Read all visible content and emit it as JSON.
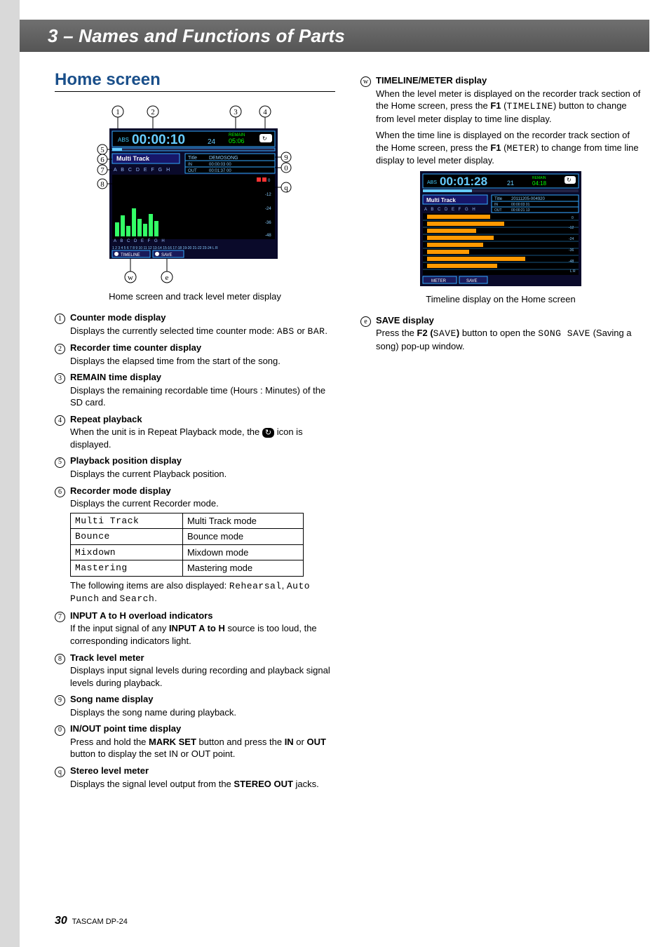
{
  "chapter_header": "3 – Names and Functions of Parts",
  "section_title": "Home screen",
  "main_caption": "Home screen and track level meter display",
  "timeline_caption": "Timeline display on the Home screen",
  "page_number": "30",
  "model": "TASCAM DP-24",
  "modes_table": [
    {
      "code": "Multi Track",
      "desc": "Multi Track mode"
    },
    {
      "code": "Bounce",
      "desc": "Bounce mode"
    },
    {
      "code": "Mixdown",
      "desc": "Mixdown mode"
    },
    {
      "code": "Mastering",
      "desc": "Mastering mode"
    }
  ],
  "items": {
    "1": {
      "n": "1",
      "title": "Counter mode display",
      "desc_a": "Displays the currently selected time counter mode: ",
      "mono_a": "ABS",
      "desc_b": " or ",
      "mono_b": "BAR",
      "desc_c": "."
    },
    "2": {
      "n": "2",
      "title": "Recorder time counter display",
      "desc": " Displays the elapsed time from the start of the song."
    },
    "3": {
      "n": "3",
      "title": "REMAIN time display",
      "desc": " Displays the remaining recordable time (Hours : Minutes) of the SD card."
    },
    "4": {
      "n": "4",
      "title": "Repeat playback",
      "desc_a": "When the unit is in Repeat Playback mode, the ",
      "desc_b": " icon is displayed."
    },
    "5": {
      "n": "5",
      "title": "Playback position display",
      "desc": "Displays the current Playback position."
    },
    "6": {
      "n": "6",
      "title": "Recorder mode display",
      "desc": "Displays the current Recorder mode.",
      "after_a": "The following items are also displayed: ",
      "mono_a": "Rehearsal",
      "after_b": ", ",
      "mono_b": "Auto Punch",
      "after_c": " and ",
      "mono_c": "Search",
      "after_d": "."
    },
    "7": {
      "n": "7",
      "title": "INPUT A to H overload indicators",
      "desc_a": "If the input signal of any ",
      "bold": "INPUT A to H",
      "desc_b": " source is too loud, the corresponding indicators light."
    },
    "8": {
      "n": "8",
      "title": "Track level meter",
      "desc": "Displays input signal levels during recording and playback signal levels during playback."
    },
    "9": {
      "n": "9",
      "title": "Song name display",
      "desc": "Displays the song name during playback."
    },
    "10": {
      "n": "0",
      "title": "IN/OUT point time display",
      "desc_a": "Press and hold the ",
      "bold_a": "MARK SET",
      "desc_b": " button and press the ",
      "bold_b": "IN",
      "desc_c": " or ",
      "bold_c": "OUT",
      "desc_d": " button to display the set IN or OUT point."
    },
    "11": {
      "n": "q",
      "title": "Stereo level meter",
      "desc_a": "Displays the signal level output from the ",
      "bold": "STEREO OUT",
      "desc_b": " jacks."
    },
    "12": {
      "n": "w",
      "title": "TIMELINE/METER display",
      "p1_a": "When the level meter is displayed on the recorder track section of the Home screen, press the ",
      "p1_bold": "F1",
      "p1_b": " (",
      "p1_mono": "TIMELINE",
      "p1_c": ") button to change from level meter display to time line display.",
      "p2_a": "When the time line is displayed on the recorder track section of the Home screen, press the ",
      "p2_bold": "F1",
      "p2_b": " (",
      "p2_mono": "METER",
      "p2_c": ") to change from time line display to level meter display."
    },
    "13": {
      "n": "e",
      "title": "SAVE display",
      "desc_a": "Press the ",
      "bold": "F2 (",
      "mono": "SAVE",
      "bold2": ")",
      "desc_b": " button to open the ",
      "mono2": "SONG SAVE",
      "desc_c": " (Saving a song) pop-up window."
    }
  },
  "shot1": {
    "abs": "ABS",
    "time": "00:00:10",
    "frames": "24",
    "remain_label": "REMAIN",
    "remain": "05:06",
    "mode": "Multi Track",
    "inputs": "A B C D E F G H",
    "title_label": "Title",
    "title": "DEMOSONG",
    "in_label": "IN",
    "in": "00:00:03 00",
    "out_label": "OUT",
    "out": "00:01:37 00",
    "scale": "0 -12 -24 -36 -48",
    "tracks": "1 2 3 4 5 6 7 8 9 10 11 12 13-14 15-16 17-18 19-20 21-22 23-24  L R",
    "f1": "TIMELINE",
    "f2": "SAVE"
  },
  "shot2": {
    "abs": "ABS",
    "time": "00:01:28",
    "frames": "21",
    "remain_label": "REMAIN",
    "remain": "04:18",
    "mode": "Multi Track",
    "inputs": "A B C D E F G H",
    "title_label": "Title",
    "title": "20111205-004920",
    "in_label": "IN",
    "in": "00:00:03 01",
    "out_label": "OUT",
    "out": "00:00:21 13",
    "scale": "0 -12 -24 -36 -48  L R",
    "f1": "METER",
    "f2": "SAVE"
  }
}
